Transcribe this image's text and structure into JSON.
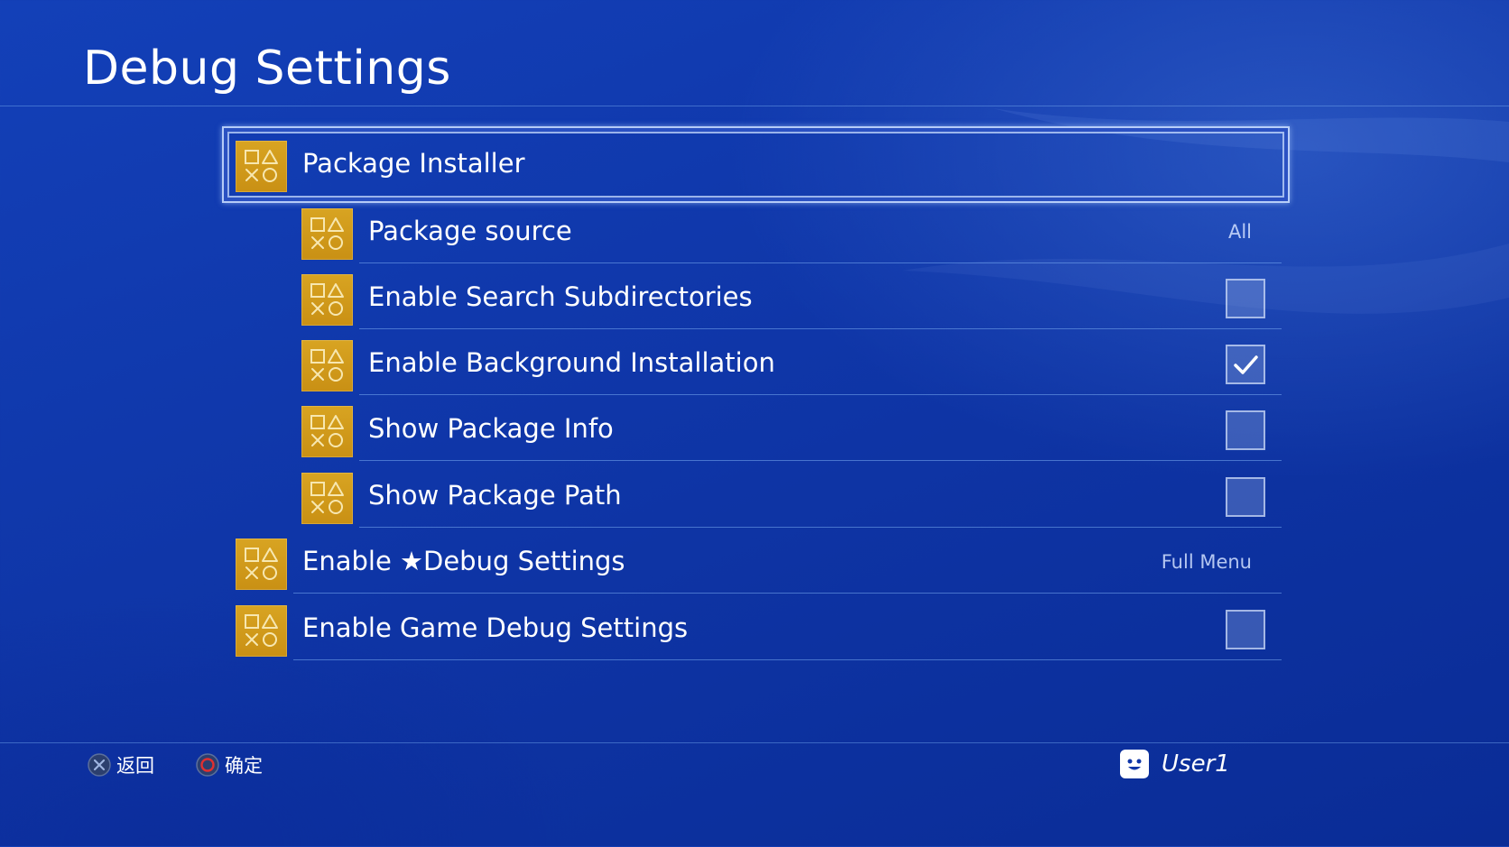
{
  "header": {
    "title": "Debug Settings"
  },
  "menu": {
    "items": [
      {
        "label": "Package Installer",
        "level": 0,
        "selected": true,
        "icon": "ps-shapes-icon"
      },
      {
        "label": "Package source",
        "level": 1,
        "value": "All",
        "icon": "ps-shapes-icon"
      },
      {
        "label": "Enable Search Subdirectories",
        "level": 1,
        "checked": false,
        "icon": "ps-shapes-icon"
      },
      {
        "label": "Enable Background Installation",
        "level": 1,
        "checked": true,
        "icon": "ps-shapes-icon"
      },
      {
        "label": "Show Package Info",
        "level": 1,
        "checked": false,
        "icon": "ps-shapes-icon"
      },
      {
        "label": "Show Package Path",
        "level": 1,
        "checked": false,
        "icon": "ps-shapes-icon"
      },
      {
        "label": "Enable ★Debug Settings",
        "level": 0,
        "value": "Full Menu",
        "icon": "ps-shapes-icon"
      },
      {
        "label": "Enable Game Debug Settings",
        "level": 0,
        "checked": false,
        "icon": "ps-shapes-icon"
      }
    ]
  },
  "footer": {
    "back": {
      "label": "返回",
      "icon": "cross-button-icon"
    },
    "confirm": {
      "label": "确定",
      "icon": "circle-button-icon"
    },
    "user": {
      "name": "User1",
      "icon": "user-avatar-icon"
    }
  },
  "colors": {
    "background": "#1340b8",
    "icon_tile": "#d8a422",
    "accent_circle": "#e03030"
  }
}
